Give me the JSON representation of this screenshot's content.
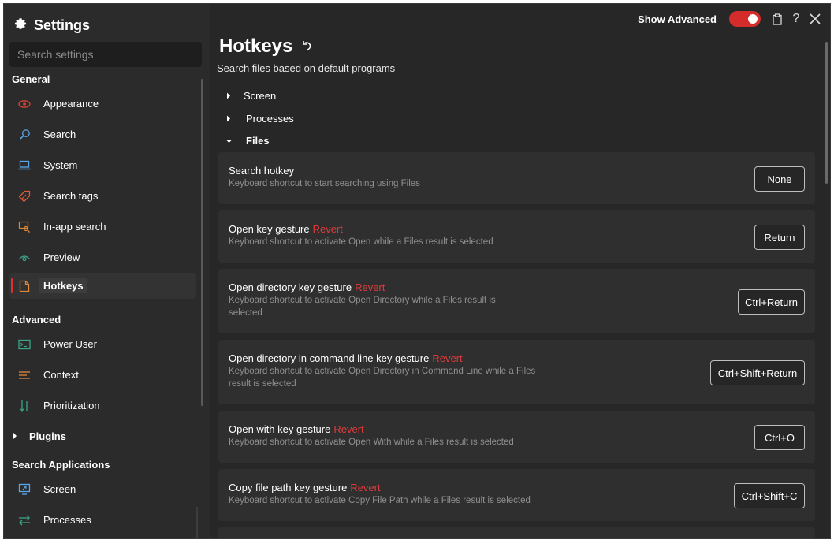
{
  "app": {
    "title": "Settings",
    "search_placeholder": "Search settings"
  },
  "sidebar": {
    "general_label": "General",
    "general_items": [
      {
        "label": "Appearance",
        "icon": "eye-icon"
      },
      {
        "label": "Search",
        "icon": "search-icon"
      },
      {
        "label": "System",
        "icon": "laptop-icon"
      },
      {
        "label": "Search tags",
        "icon": "tag-icon"
      },
      {
        "label": "In-app search",
        "icon": "chat-search-icon"
      },
      {
        "label": "Preview",
        "icon": "preview-eye-icon"
      },
      {
        "label": "Hotkeys",
        "icon": "document-icon",
        "active": true
      }
    ],
    "advanced_label": "Advanced",
    "advanced_items": [
      {
        "label": "Power User",
        "icon": "terminal-icon"
      },
      {
        "label": "Context",
        "icon": "context-icon"
      },
      {
        "label": "Prioritization",
        "icon": "sort-icon"
      }
    ],
    "plugins_label": "Plugins",
    "search_apps_label": "Search Applications",
    "search_apps_items": [
      {
        "label": "Screen",
        "icon": "screen-icon"
      },
      {
        "label": "Processes",
        "icon": "processes-icon"
      }
    ]
  },
  "topbar": {
    "show_advanced_label": "Show Advanced",
    "show_advanced_on": true
  },
  "main": {
    "title": "Hotkeys",
    "subtitle": "Search files based on default programs",
    "tree": [
      {
        "label": "Screen",
        "expanded": false
      },
      {
        "label": "Processes",
        "expanded": false
      },
      {
        "label": "Files",
        "expanded": true
      }
    ],
    "cards": [
      {
        "title": "Search hotkey",
        "revert": "",
        "desc": "Keyboard shortcut to start searching using Files",
        "key": "None"
      },
      {
        "title": "Open key gesture",
        "revert": "Revert",
        "desc": "Keyboard shortcut to activate Open while a Files result is selected",
        "key": "Return"
      },
      {
        "title": "Open directory key gesture",
        "revert": "Revert",
        "desc": "Keyboard shortcut to activate Open Directory while a Files result is selected",
        "key": "Ctrl+Return"
      },
      {
        "title": "Open directory in command line key gesture",
        "revert": "Revert",
        "desc": "Keyboard shortcut to activate Open Directory in Command Line while a Files result is selected",
        "key": "Ctrl+Shift+Return"
      },
      {
        "title": "Open with key gesture",
        "revert": "Revert",
        "desc": "Keyboard shortcut to activate Open With while a Files result is selected",
        "key": "Ctrl+O"
      },
      {
        "title": "Copy file path key gesture",
        "revert": "Revert",
        "desc": "Keyboard shortcut to activate Copy File Path while a Files result is selected",
        "key": "Ctrl+Shift+C"
      }
    ]
  },
  "colors": {
    "accent": "#d42b2b",
    "revert": "#e03a3a",
    "background": "#272727",
    "sidebar": "#2b2b2b",
    "card": "#2f2f2f"
  }
}
